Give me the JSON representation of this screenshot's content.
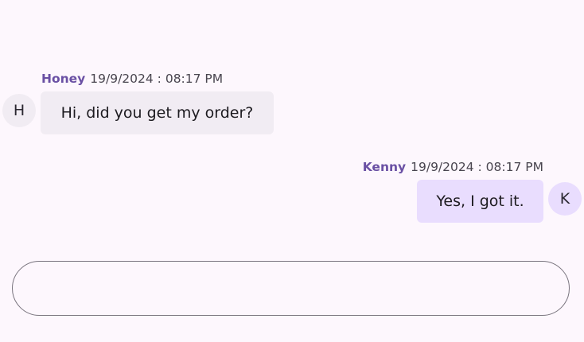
{
  "messages": [
    {
      "author": "Honey",
      "avatar_initial": "H",
      "timestamp": "19/9/2024 : 08:17 PM",
      "text": "Hi, did you get my order?",
      "direction": "incoming"
    },
    {
      "author": "Kenny",
      "avatar_initial": "K",
      "timestamp": "19/9/2024 : 08:17 PM",
      "text": "Yes, I got it.",
      "direction": "outgoing"
    }
  ],
  "composer": {
    "value": "",
    "placeholder": ""
  },
  "colors": {
    "background": "#fdf7fd",
    "author_name": "#6a50a4",
    "incoming_bubble": "#f1ecf3",
    "outgoing_bubble": "#e9ddfe",
    "input_border": "#79747e"
  }
}
